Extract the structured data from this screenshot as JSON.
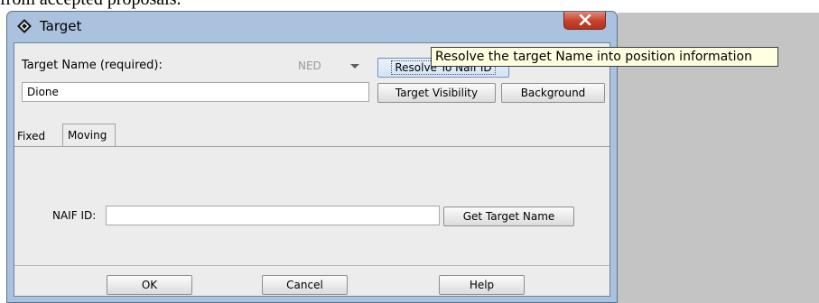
{
  "background_text": "from accepted proposals.",
  "window": {
    "title": "Target",
    "icon": "diamond-app-icon",
    "close_icon": "close-x-icon"
  },
  "form": {
    "target_name_label": "Target Name (required):",
    "target_name_value": "Dione",
    "resolver_select_value": "NED",
    "resolve_button": "Resolve To Naif ID",
    "visibility_button": "Target Visibility",
    "background_button": "Background"
  },
  "tabs": {
    "fixed": "Fixed",
    "moving": "Moving",
    "active": "Moving"
  },
  "moving_panel": {
    "naif_label": "NAIF ID:",
    "naif_value": "",
    "get_name_button": "Get Target Name"
  },
  "footer": {
    "ok": "OK",
    "cancel": "Cancel",
    "help": "Help"
  },
  "tooltip": {
    "text": "Resolve the target Name into position information"
  },
  "colors": {
    "window_frame": "#aac2dd",
    "client_bg": "#ececec",
    "close_button": "#c7402a",
    "tooltip_bg": "#ffffe1"
  }
}
